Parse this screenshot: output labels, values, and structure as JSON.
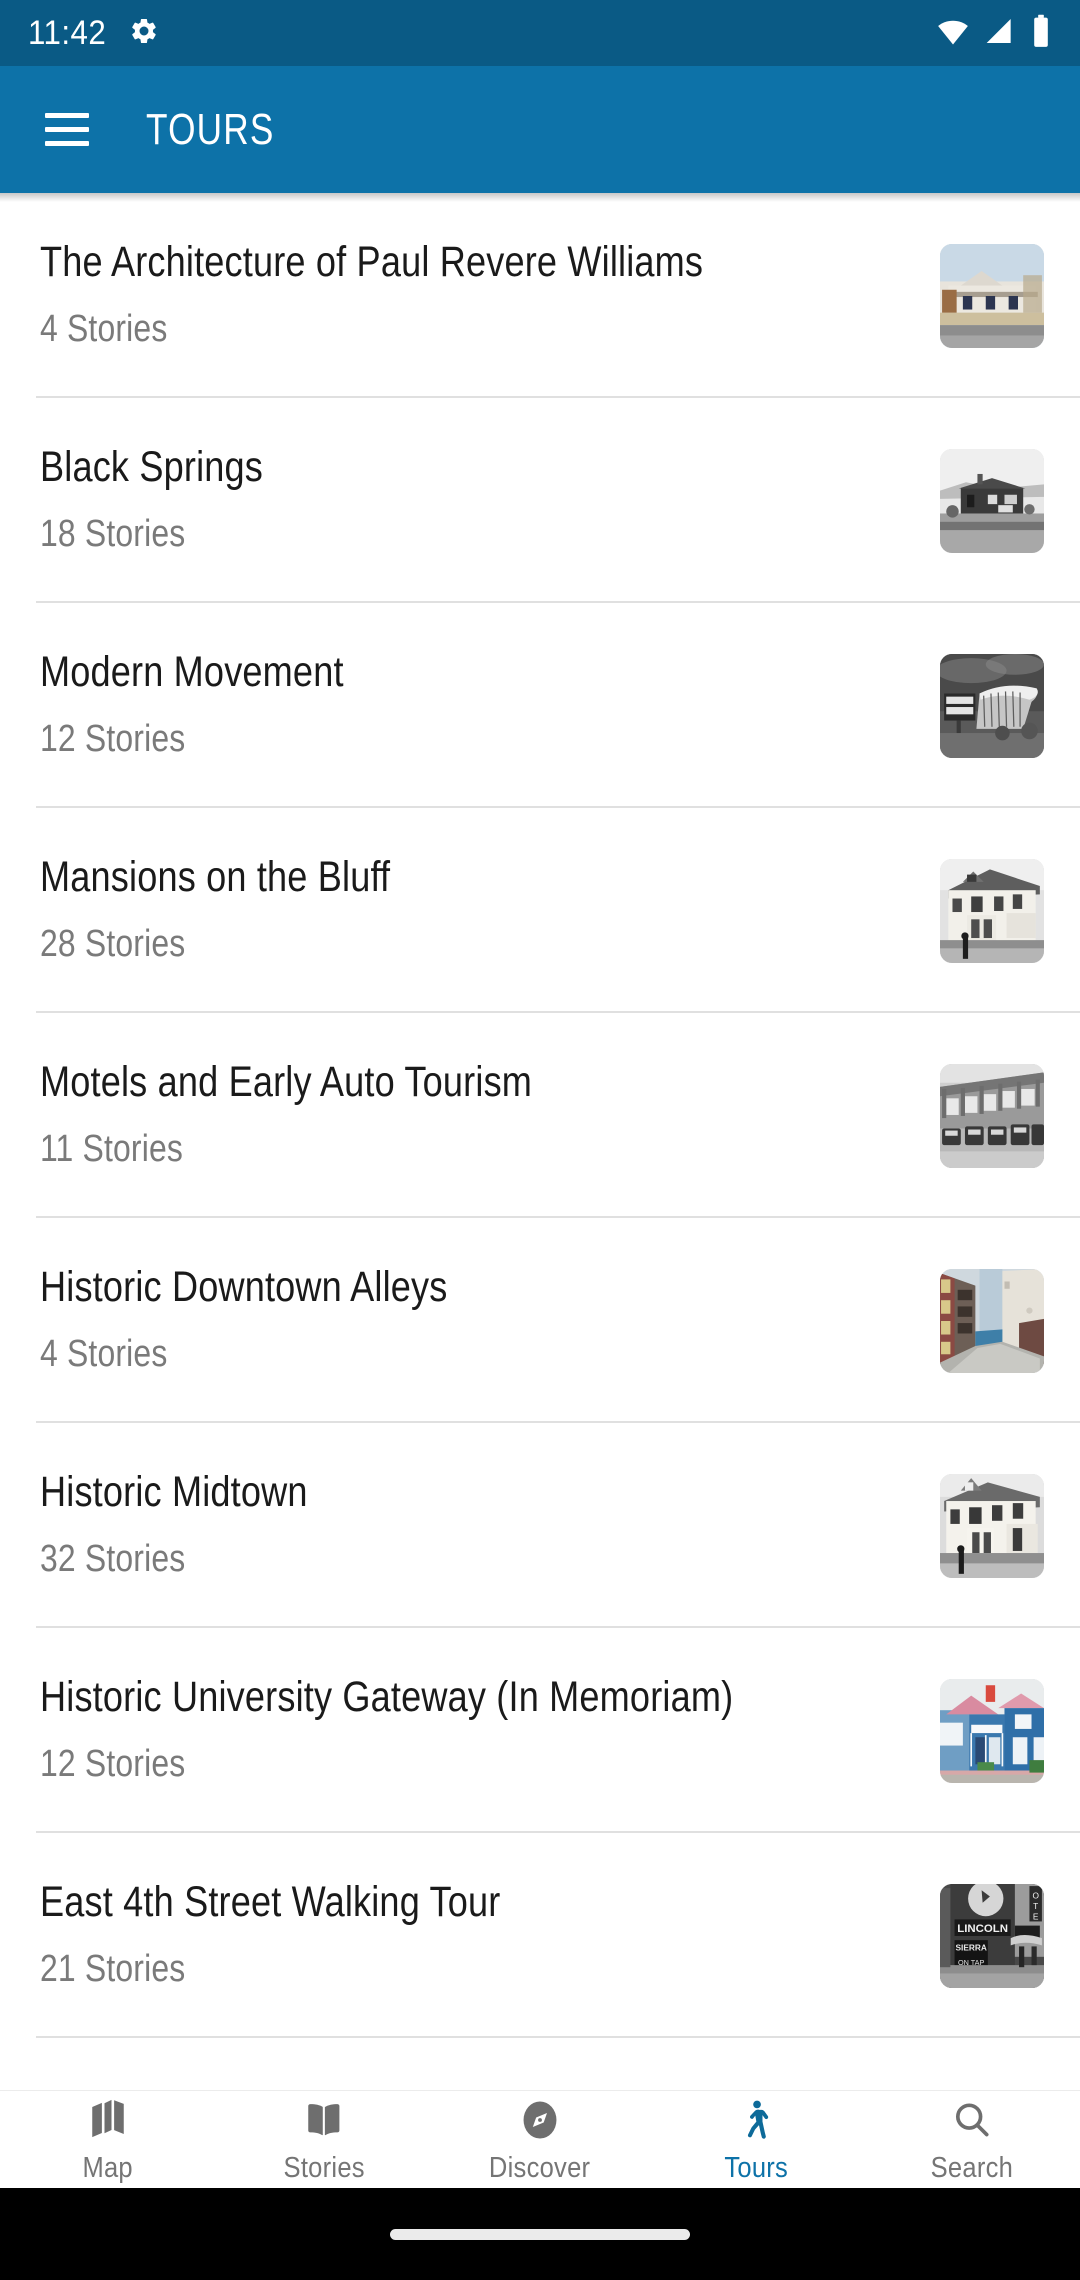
{
  "status_bar": {
    "time": "11:42",
    "background_color": "#0A5A85",
    "icons": [
      "gear-icon",
      "wifi-icon",
      "cell-signal-icon",
      "battery-icon"
    ]
  },
  "app_bar": {
    "title": "TOURS",
    "menu_icon": "hamburger-menu-icon",
    "background_color": "#0D72A8",
    "text_color": "#FFFFFF"
  },
  "tours": [
    {
      "title": "The Architecture of Paul Revere Williams",
      "stories": "4 Stories",
      "thumb": "house-color-photo"
    },
    {
      "title": "Black Springs",
      "stories": "18 Stories",
      "thumb": "historic-bw-cabin"
    },
    {
      "title": "Modern Movement",
      "stories": "12 Stories",
      "thumb": "planetarium-bw"
    },
    {
      "title": "Mansions on the Bluff",
      "stories": "28 Stories",
      "thumb": "mansion-bw"
    },
    {
      "title": "Motels and Early Auto Tourism",
      "stories": "11 Stories",
      "thumb": "vintage-cars-bw"
    },
    {
      "title": "Historic Downtown Alleys",
      "stories": "4 Stories",
      "thumb": "alley-color-photo"
    },
    {
      "title": "Historic Midtown",
      "stories": "32 Stories",
      "thumb": "white-house-bw"
    },
    {
      "title": "Historic University Gateway (In Memoriam)",
      "stories": "12 Stories",
      "thumb": "blue-victorian-color"
    },
    {
      "title": "East 4th Street Walking Tour",
      "stories": "21 Stories",
      "thumb": "lincoln-bar-bw"
    }
  ],
  "bottom_nav": {
    "active_index": 3,
    "active_color": "#0D72A8",
    "inactive_color": "#757575",
    "items": [
      {
        "label": "Map",
        "icon": "map-icon"
      },
      {
        "label": "Stories",
        "icon": "book-icon"
      },
      {
        "label": "Discover",
        "icon": "compass-icon"
      },
      {
        "label": "Tours",
        "icon": "walking-person-icon"
      },
      {
        "label": "Search",
        "icon": "search-icon"
      }
    ]
  }
}
